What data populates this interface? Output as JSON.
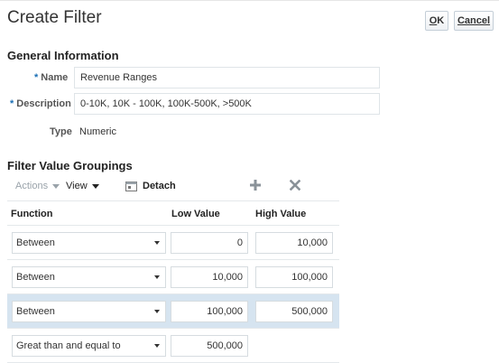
{
  "page": {
    "title": "Create Filter",
    "ok_label": "OK",
    "cancel_label": "Cancel"
  },
  "general": {
    "heading": "General Information",
    "name_label": "Name",
    "name_value": "Revenue Ranges",
    "description_label": "Description",
    "description_value": "0-10K, 10K - 100K, 100K-500K, >500K",
    "type_label": "Type",
    "type_value": "Numeric"
  },
  "groupings": {
    "heading": "Filter Value Groupings",
    "toolbar": {
      "actions_label": "Actions",
      "view_label": "View",
      "detach_label": "Detach"
    },
    "columns": [
      "Function",
      "Low Value",
      "High Value"
    ],
    "rows": [
      {
        "function": "Between",
        "low": "0",
        "high": "10,000",
        "selected": false
      },
      {
        "function": "Between",
        "low": "10,000",
        "high": "100,000",
        "selected": false
      },
      {
        "function": "Between",
        "low": "100,000",
        "high": "500,000",
        "selected": true
      },
      {
        "function": "Great than and equal to",
        "low": "500,000",
        "high": "",
        "selected": false
      }
    ]
  },
  "colors": {
    "selected_row": "#d6e4f0",
    "required_marker": "#1a6fb5"
  }
}
